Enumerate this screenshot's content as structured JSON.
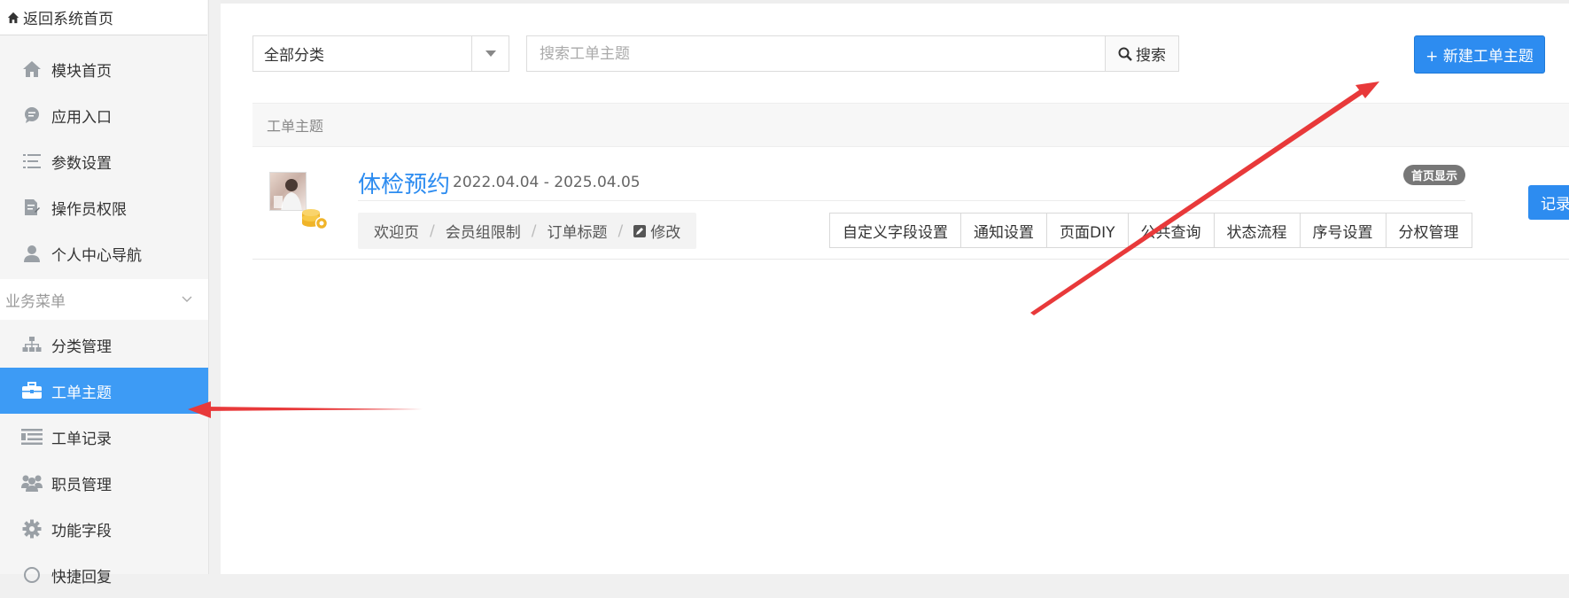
{
  "sidebar": {
    "back_home": "返回系统首页",
    "top_items": [
      {
        "label": "模块首页",
        "icon": "home-icon"
      },
      {
        "label": "应用入口",
        "icon": "chat-icon"
      },
      {
        "label": "参数设置",
        "icon": "list-settings-icon"
      },
      {
        "label": "操作员权限",
        "icon": "document-edit-icon"
      },
      {
        "label": "个人中心导航",
        "icon": "user-icon"
      }
    ],
    "group_title": "业务菜单",
    "business_items": [
      {
        "label": "分类管理",
        "icon": "sitemap-icon"
      },
      {
        "label": "工单主题",
        "icon": "briefcase-icon",
        "active": true
      },
      {
        "label": "工单记录",
        "icon": "list-icon"
      },
      {
        "label": "职员管理",
        "icon": "users-icon"
      },
      {
        "label": "功能字段",
        "icon": "gear-icon"
      },
      {
        "label": "快捷回复",
        "icon": "reply-icon"
      }
    ]
  },
  "toolbar": {
    "category_value": "全部分类",
    "search_placeholder": "搜索工单主题",
    "search_label": "搜索",
    "new_label": "+ 新建工单主题"
  },
  "table": {
    "header": "工单主题"
  },
  "item": {
    "title": "体检预约",
    "date_range": "2022.04.04 - 2025.04.05",
    "badge": "首页显示",
    "crumbs": [
      "欢迎页",
      "会员组限制",
      "订单标题"
    ],
    "edit_label": "修改",
    "actions": [
      "自定义字段设置",
      "通知设置",
      "页面DIY",
      "公共查询",
      "状态流程",
      "序号设置",
      "分权管理"
    ],
    "record_label": "记录"
  },
  "colors": {
    "accent": "#2d8cf0",
    "active_nav": "#3d9bf5",
    "annotation_arrow": "#e8393a",
    "badge": "#777777"
  }
}
